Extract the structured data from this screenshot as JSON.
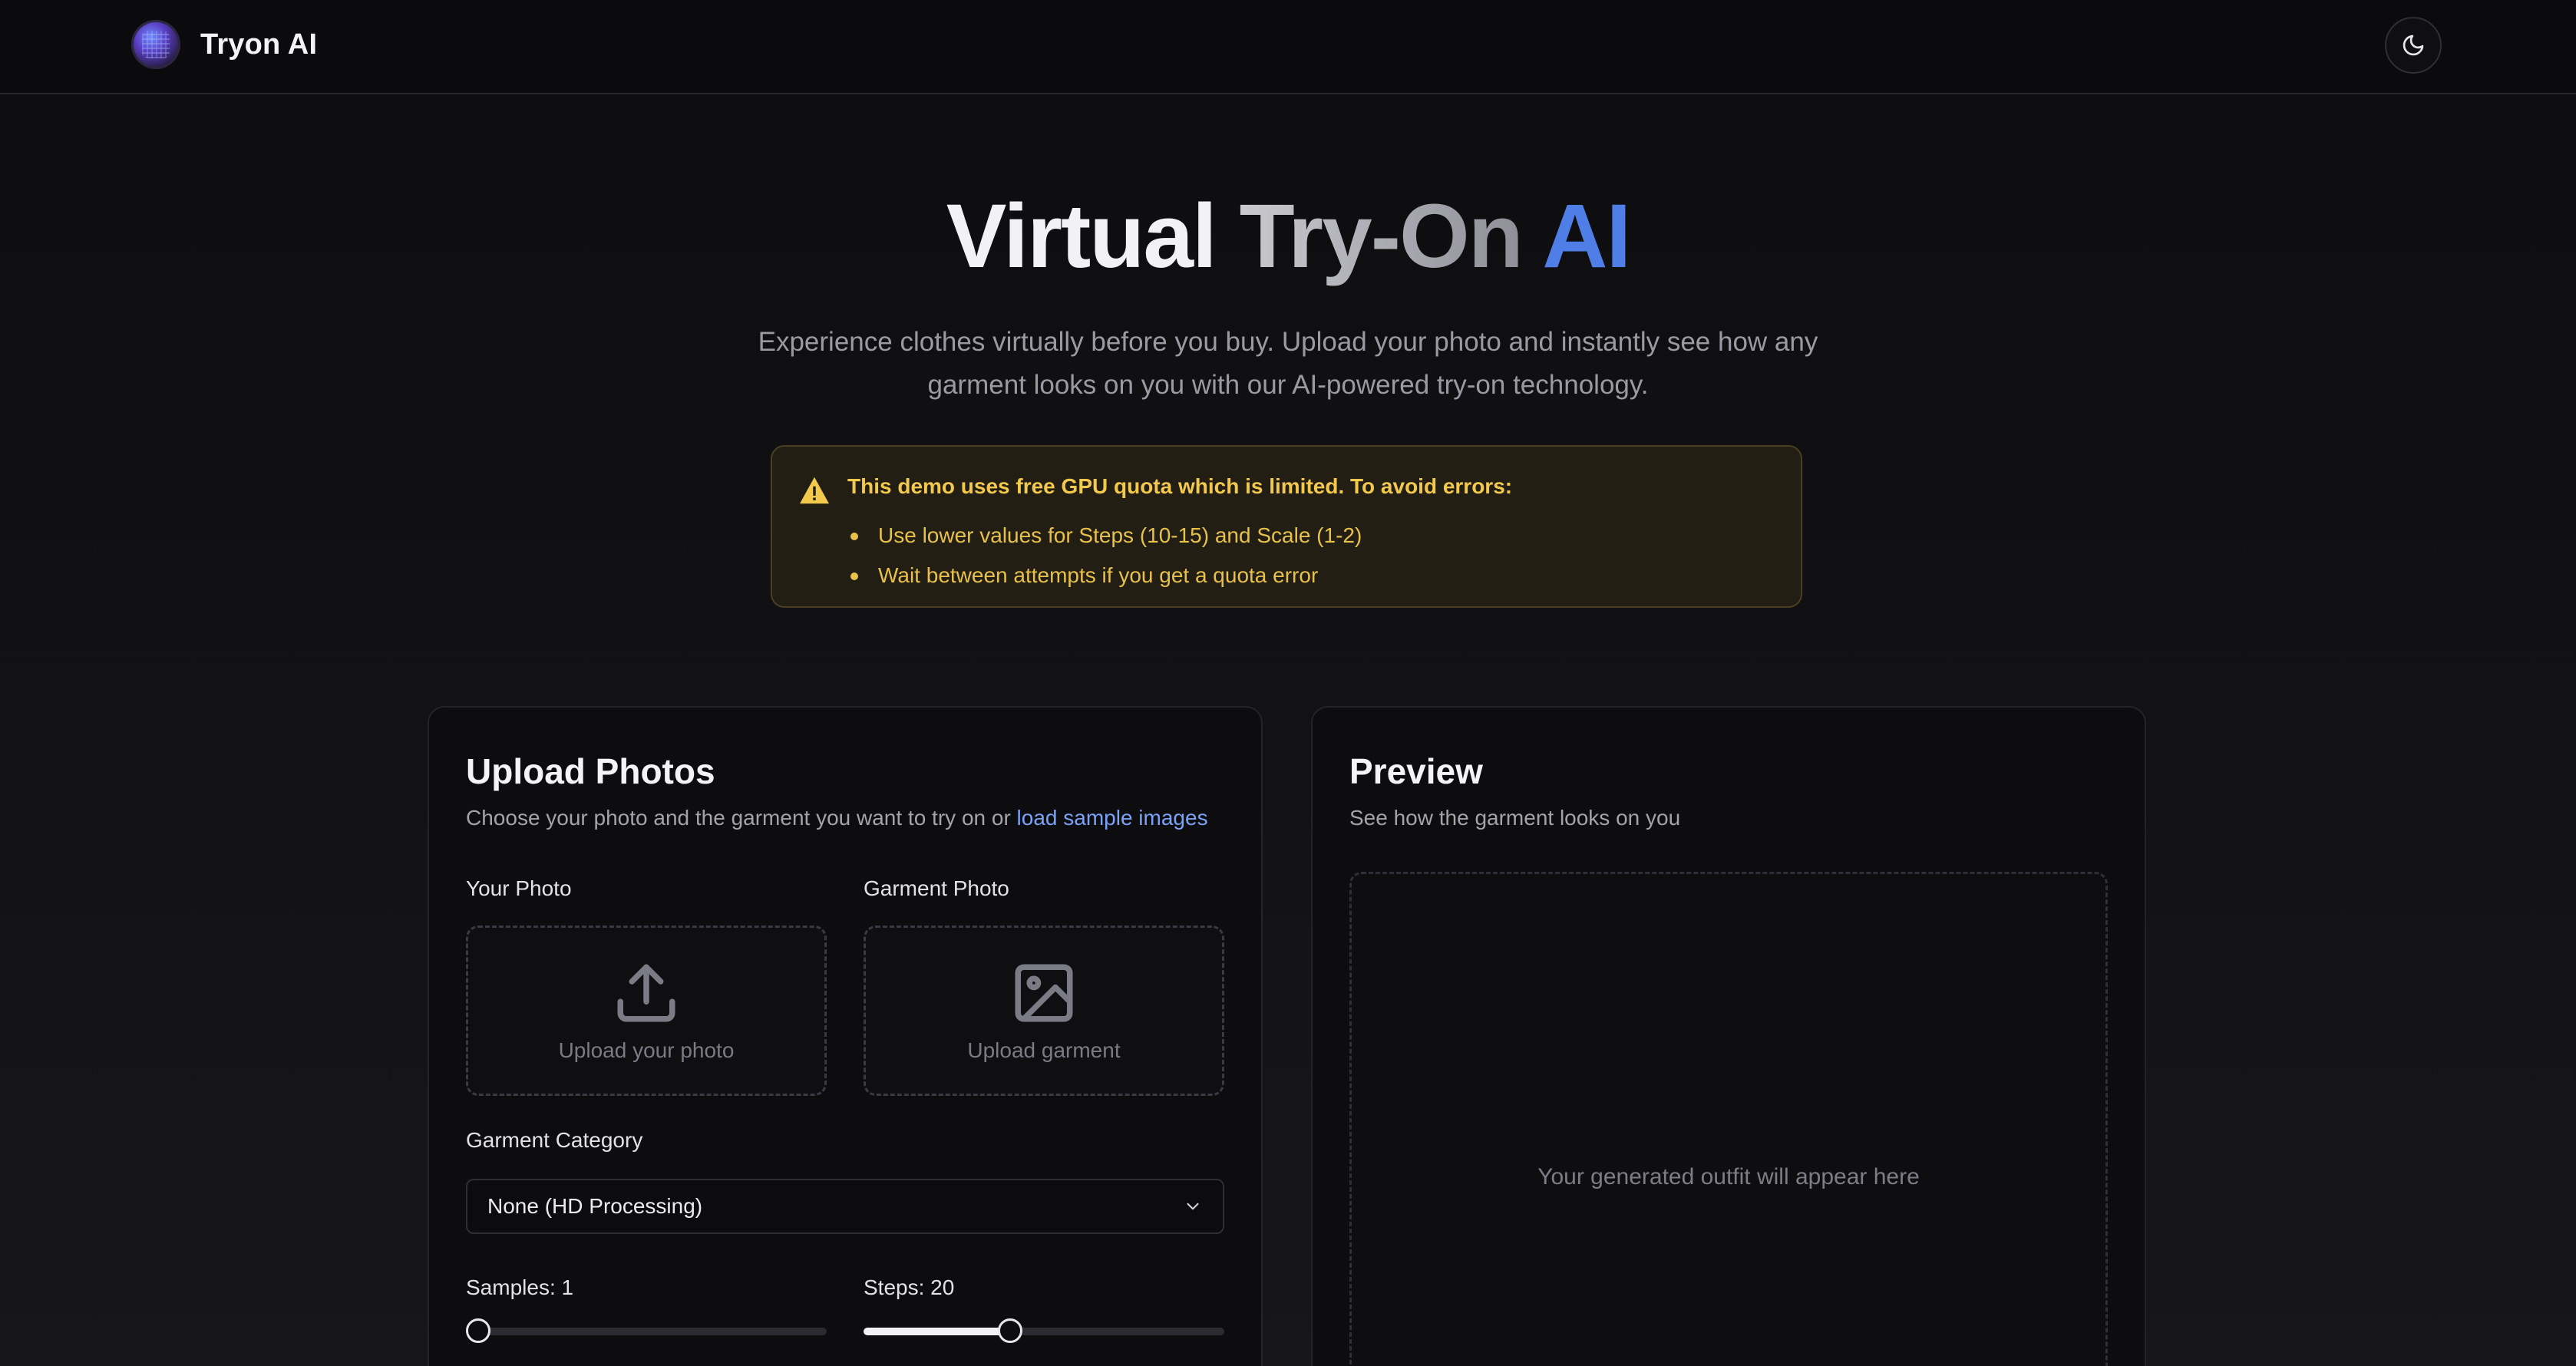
{
  "header": {
    "brand_name": "Tryon AI",
    "theme_toggle_icon": "moon-icon"
  },
  "hero": {
    "title_part1": "Virtual",
    "title_part2": "Try-On",
    "title_part3": "AI",
    "subtitle": "Experience clothes virtually before you buy. Upload your photo and instantly see how any garment looks on you with our AI-powered try-on technology."
  },
  "warning": {
    "title": "This demo uses free GPU quota which is limited. To avoid errors:",
    "items": [
      "Use lower values for Steps (10-15) and Scale (1-2)",
      "Wait between attempts if you get a quota error"
    ]
  },
  "upload_card": {
    "title": "Upload Photos",
    "description": "Choose your photo and the garment you want to try on or",
    "sample_link": "load sample images",
    "your_photo_label": "Your Photo",
    "your_photo_text": "Upload your photo",
    "garment_photo_label": "Garment Photo",
    "garment_photo_text": "Upload garment",
    "category_label": "Garment Category",
    "category_value": "None (HD Processing)",
    "samples_label": "Samples: 1",
    "samples_fraction": 0.0,
    "steps_label": "Steps: 20",
    "steps_fraction": 0.4
  },
  "preview_card": {
    "title": "Preview",
    "description": "See how the garment looks on you",
    "placeholder": "Your generated outfit will appear here"
  },
  "colors": {
    "accent_blue": "#4f7fe6",
    "link_blue": "#7aa2f7",
    "warning_yellow": "#f2c94c"
  }
}
